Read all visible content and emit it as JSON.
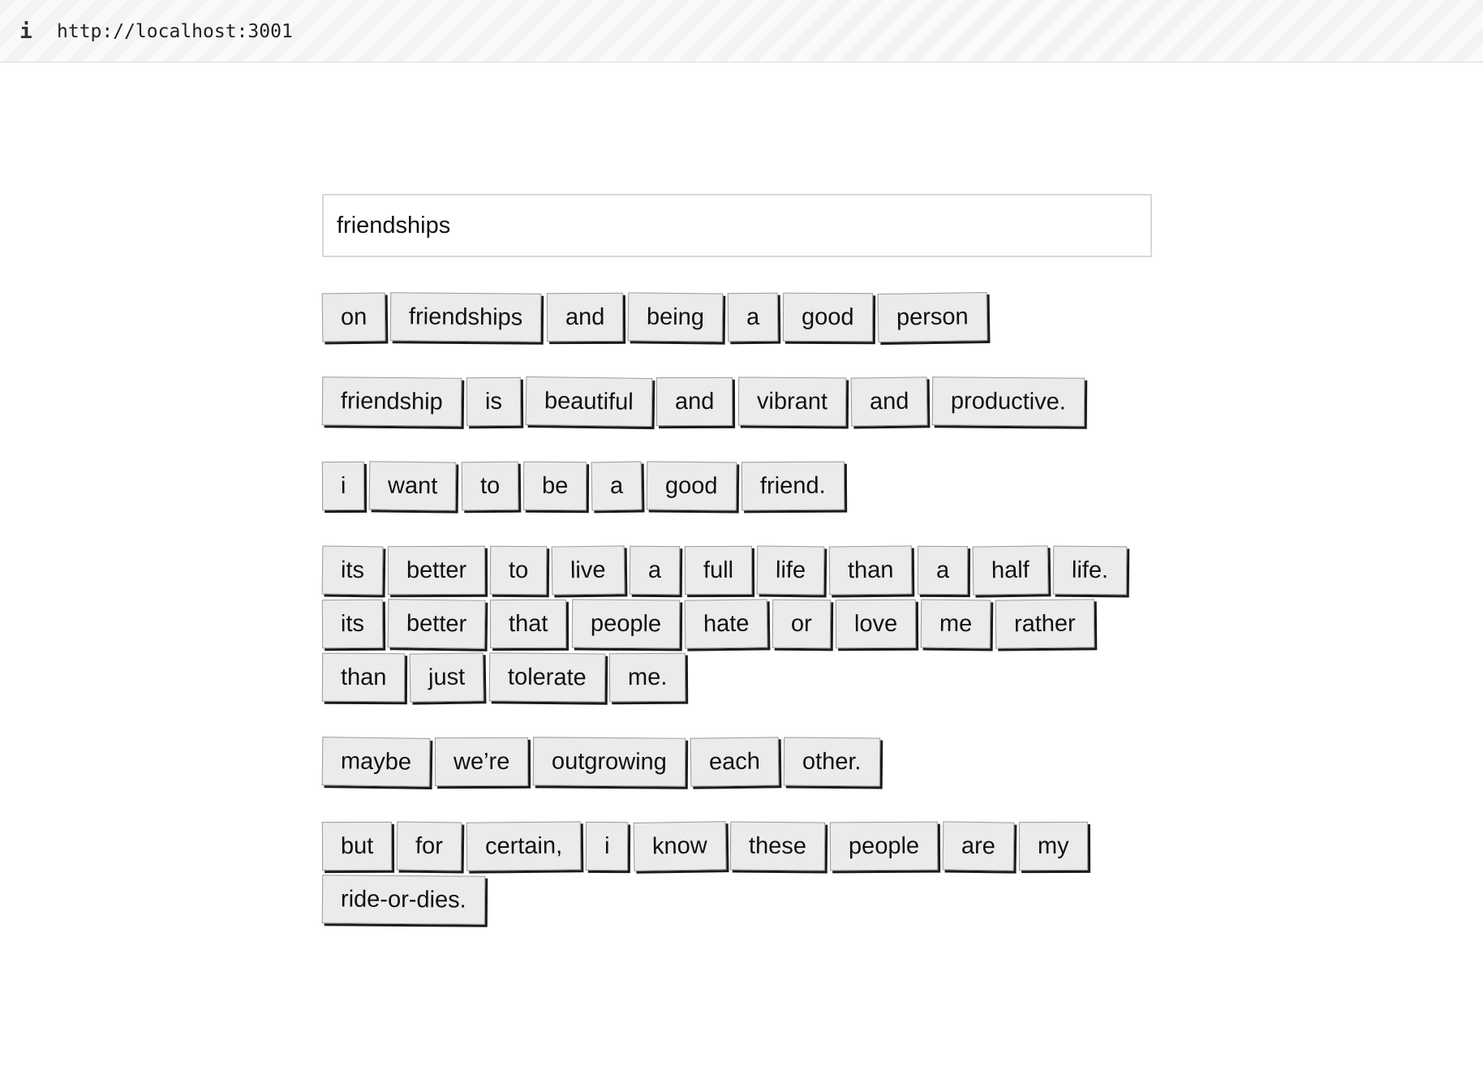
{
  "browser": {
    "info_icon": "i",
    "url": "http://localhost:3001"
  },
  "title_input": {
    "value": "friendships"
  },
  "stanzas": [
    {
      "lines": [
        [
          "on",
          "friendships",
          "and",
          "being",
          "a",
          "good",
          "person"
        ]
      ]
    },
    {
      "lines": [
        [
          "friendship",
          "is",
          "beautiful",
          "and",
          "vibrant",
          "and",
          "productive."
        ]
      ]
    },
    {
      "lines": [
        [
          "i",
          "want",
          "to",
          "be",
          "a",
          "good",
          "friend."
        ]
      ]
    },
    {
      "lines": [
        [
          "its",
          "better",
          "to",
          "live",
          "a",
          "full",
          "life",
          "than",
          "a",
          "half",
          "life."
        ],
        [
          "its",
          "better",
          "that",
          "people",
          "hate",
          "or",
          "love",
          "me",
          "rather"
        ],
        [
          "than",
          "just",
          "tolerate",
          "me."
        ]
      ]
    },
    {
      "lines": [
        [
          "maybe",
          "we’re",
          "outgrowing",
          "each",
          "other."
        ]
      ]
    },
    {
      "lines": [
        [
          "but",
          "for",
          "certain,",
          "i",
          "know",
          "these",
          "people",
          "are",
          "my"
        ],
        [
          "ride-or-dies."
        ]
      ]
    }
  ]
}
